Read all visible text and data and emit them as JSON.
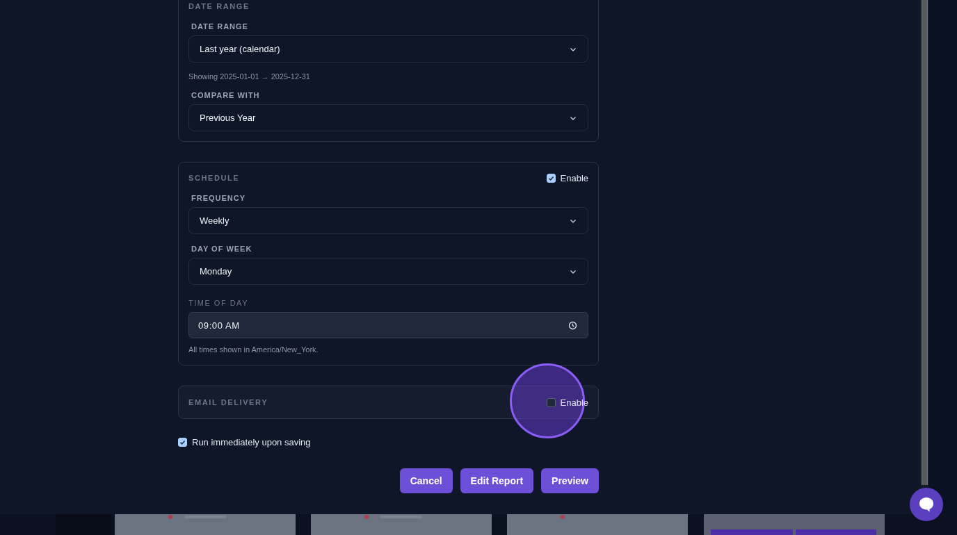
{
  "sections": [
    {
      "title": "DATE RANGE",
      "fields": [
        {
          "kind": "select",
          "label": "DATE RANGE",
          "value": "Last year (calendar)"
        },
        {
          "kind": "hint",
          "text": "Showing 2025-01-01 → 2025-12-31"
        },
        {
          "kind": "select",
          "label": "COMPARE WITH",
          "value": "Previous Year"
        }
      ]
    },
    {
      "title": "SCHEDULE",
      "enable": {
        "label": "Enable",
        "checked": true
      },
      "fields": [
        {
          "kind": "select",
          "label": "FREQUENCY",
          "value": "Weekly"
        },
        {
          "kind": "select",
          "label": "DAY OF WEEK",
          "value": "Monday"
        },
        {
          "kind": "time",
          "label": "TIME OF DAY",
          "value": "09:00 AM"
        },
        {
          "kind": "hint",
          "text": "All times shown in America/New_York."
        }
      ]
    },
    {
      "title": "EMAIL DELIVERY",
      "enable": {
        "label": "Enable",
        "checked": false
      }
    }
  ],
  "run_immediately": {
    "label": "Run immediately upon saving",
    "checked": true
  },
  "buttons": [
    "Cancel",
    "Edit Report",
    "Preview"
  ]
}
